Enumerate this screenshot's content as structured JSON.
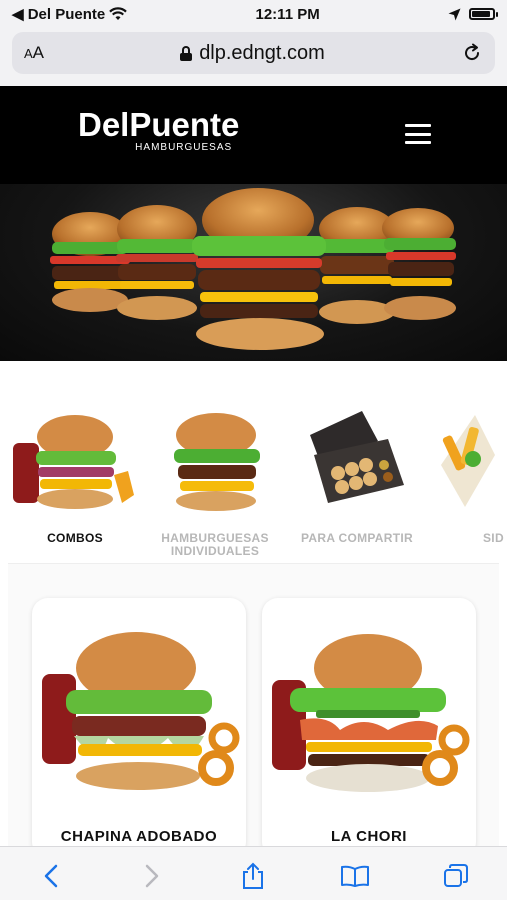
{
  "status_bar": {
    "carrier": "◀ Del Puente",
    "time": "12:11 PM"
  },
  "browser": {
    "aa_label_small": "A",
    "aa_label_large": "A",
    "url": "dlp.edngt.com"
  },
  "site": {
    "logo_main": "DelPuente",
    "logo_sub": "HAMBURGUESAS"
  },
  "categories": [
    {
      "label": "COMBOS",
      "active": true
    },
    {
      "label": "HAMBURGUESAS INDIVIDUALES",
      "active": false
    },
    {
      "label": "PARA COMPARTIR",
      "active": false
    },
    {
      "label": "SID",
      "active": false
    }
  ],
  "products": [
    {
      "name": "CHAPINA ADOBADO"
    },
    {
      "name": "LA CHORI"
    }
  ],
  "icons": [
    "wifi-icon",
    "location-arrow-icon",
    "battery-icon",
    "lock-icon",
    "reload-icon",
    "menu-icon",
    "back-icon",
    "forward-icon",
    "share-icon",
    "bookmarks-icon",
    "tabs-icon"
  ],
  "colors": {
    "header_bg": "#000000",
    "accent_blue": "#1a73e8",
    "inactive_label": "#b7b7b7"
  }
}
